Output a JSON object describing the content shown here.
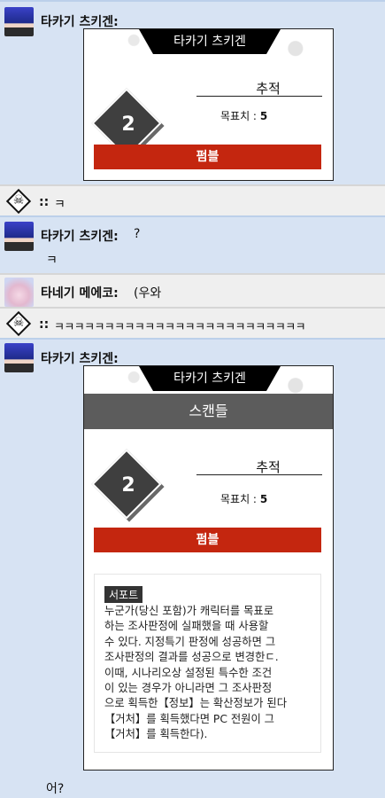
{
  "messages": {
    "m1": {
      "sender": "타카기 츠키겐:"
    },
    "m2": {
      "sender": "::",
      "text": "ㅋ"
    },
    "m3": {
      "sender": "타카기 츠키겐:",
      "inline": "?",
      "text": "ㅋ"
    },
    "m4": {
      "sender": "타네기 메에코:",
      "inline": "(우와"
    },
    "m5": {
      "sender": "::",
      "text": "ㅋㅋㅋㅋㅋㅋㅋㅋㅋㅋㅋㅋㅋㅋㅋㅋㅋㅋㅋㅋㅋㅋㅋㅋㅋ"
    },
    "m6": {
      "sender": "타카기 츠키겐:",
      "after": "어?"
    }
  },
  "card1": {
    "header": "타카기 츠키겐",
    "level": "2",
    "skill": "추적",
    "target_label": "목표치 :",
    "target_value": "5",
    "fumble": "펌블"
  },
  "card2": {
    "header": "타카기 츠키겐",
    "subtitle": "스캔들",
    "level": "2",
    "skill": "추적",
    "target_label": "목표치 :",
    "target_value": "5",
    "fumble": "펌블",
    "support_tag": "서포트",
    "support_text": "누군가(당신 포함)가 캐릭터를 목표로\n하는 조사판정에 실패했을 때 사용할\n수 있다. 지정특기 판정에 성공하면 그\n조사판정의 결과를 성공으로 변경한ㄷ.\n이때, 시나리오상 설정된 특수한 조건\n이 있는 경우가 아니라면 그 조사판정\n으로 획득한【정보】는 확산정보가 된다\n【거처】를 획득했다면 PC 전원이 그\n【거처】를 획득한다)."
  }
}
